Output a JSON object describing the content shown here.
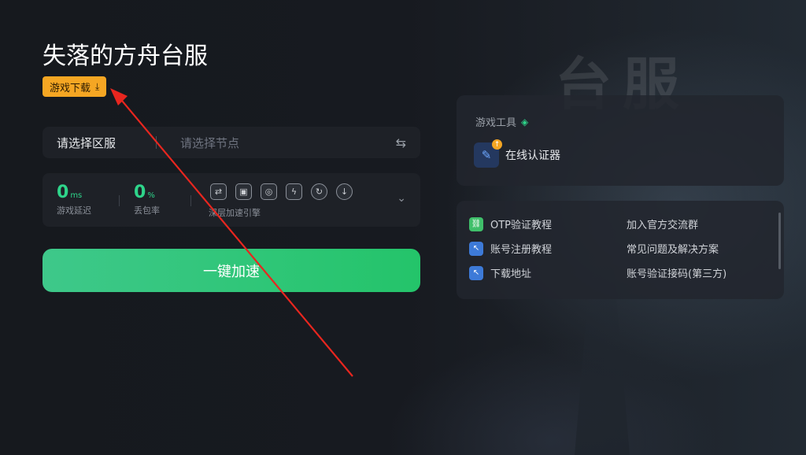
{
  "page": {
    "title": "失落的方舟台服"
  },
  "background": {
    "watermark": "台服"
  },
  "download": {
    "label": "游戏下载",
    "icon": "download-icon",
    "color": "#f5a623"
  },
  "region_bar": {
    "region_placeholder": "请选择区服",
    "node_placeholder": "请选择节点",
    "swap_icon": "swap-arrows-icon"
  },
  "stats": {
    "latency": {
      "value": "0",
      "unit": "ms",
      "label": "游戏延迟"
    },
    "loss": {
      "value": "0",
      "unit": "%",
      "label": "丢包率"
    },
    "engine_label": "深层加速引擎",
    "engine_icons": [
      "link-icon",
      "image-icon",
      "globe-icon",
      "bolt-icon",
      "refresh-icon",
      "download-circle-icon"
    ]
  },
  "accelerate": {
    "label": "一键加速",
    "color": "#2ec46e"
  },
  "tools": {
    "title": "游戏工具",
    "item_label": "在线认证器",
    "item_icon": "authenticator-icon"
  },
  "links": {
    "left": [
      {
        "label": "OTP验证教程",
        "icon": "link-chain-icon"
      },
      {
        "label": "账号注册教程",
        "icon": "cursor-click-icon"
      },
      {
        "label": "下载地址",
        "icon": "cursor-click-icon"
      }
    ],
    "right": [
      {
        "label": "加入官方交流群"
      },
      {
        "label": "常见问题及解决方案"
      },
      {
        "label": "账号验证接码(第三方)"
      }
    ]
  },
  "theme": {
    "accent_green": "#2ed48a",
    "arrow_red": "#e8261f"
  }
}
